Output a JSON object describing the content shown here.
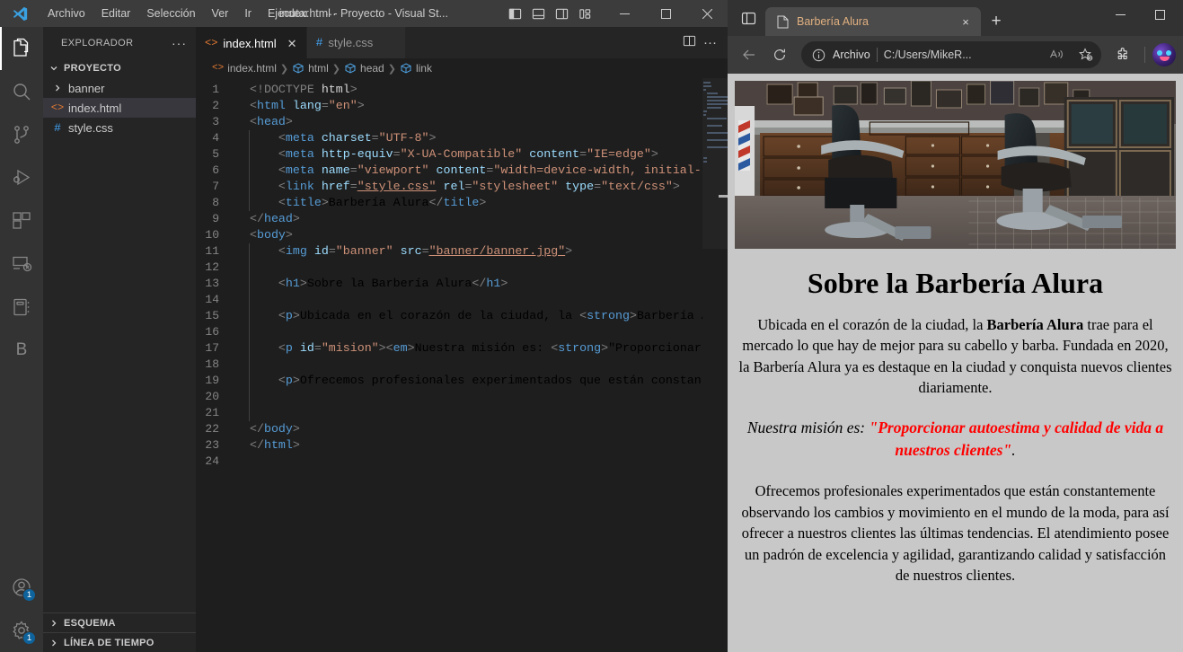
{
  "vscode": {
    "titlebar": {
      "title": "index.html - Proyecto - Visual St...",
      "menu": [
        "Archivo",
        "Editar",
        "Selección",
        "Ver",
        "Ir",
        "Ejecutar",
        "⋯"
      ],
      "layout_icons": [
        "toggle-primary-sidebar-icon",
        "toggle-panel-icon",
        "toggle-secondary-sidebar-icon",
        "customize-layout-icon"
      ],
      "window_buttons": [
        "minimize",
        "maximize",
        "close"
      ]
    },
    "activitybar": [
      {
        "name": "explorer",
        "badge": ""
      },
      {
        "name": "search",
        "badge": ""
      },
      {
        "name": "source-control",
        "badge": ""
      },
      {
        "name": "run-and-debug",
        "badge": ""
      },
      {
        "name": "extensions",
        "badge": ""
      },
      {
        "name": "remote-explorer",
        "badge": ""
      },
      {
        "name": "notebook",
        "badge": ""
      },
      {
        "name": "bookmarks",
        "badge": "",
        "letter": "B"
      },
      {
        "name": "accounts",
        "badge": "1"
      },
      {
        "name": "manage-settings",
        "badge": "1"
      }
    ],
    "sidebar": {
      "header": "EXPLORADOR",
      "more_actions": "···",
      "project": "PROYECTO",
      "files": [
        {
          "label": "banner",
          "type": "folder",
          "selected": false
        },
        {
          "label": "index.html",
          "type": "html",
          "selected": true
        },
        {
          "label": "style.css",
          "type": "css",
          "selected": false
        }
      ],
      "sections": [
        "ESQUEMA",
        "LÍNEA DE TIEMPO"
      ]
    },
    "tabs": [
      {
        "label": "index.html",
        "type": "html",
        "active": true,
        "closable": true
      },
      {
        "label": "style.css",
        "type": "css",
        "active": false,
        "closable": false
      }
    ],
    "tab_actions": [
      "split-editor-icon",
      "more-actions-icon"
    ],
    "breadcrumb": [
      "index.html",
      "html",
      "head",
      "link"
    ],
    "code_lines": [
      {
        "n": 1,
        "text": "<!DOCTYPE html>"
      },
      {
        "n": 2,
        "text": "<html lang=\"en\">"
      },
      {
        "n": 3,
        "text": "<head>"
      },
      {
        "n": 4,
        "text": "    <meta charset=\"UTF-8\">"
      },
      {
        "n": 5,
        "text": "    <meta http-equiv=\"X-UA-Compatible\" content=\"IE=edge\">"
      },
      {
        "n": 6,
        "text": "    <meta name=\"viewport\" content=\"width=device-width, initial-scal"
      },
      {
        "n": 7,
        "text": "    <link href=\"style.css\" rel=\"stylesheet\" type=\"text/css\">"
      },
      {
        "n": 8,
        "text": "    <title>Barbería Alura</title>"
      },
      {
        "n": 9,
        "text": "</head>"
      },
      {
        "n": 10,
        "text": "<body>"
      },
      {
        "n": 11,
        "text": "    <img id=\"banner\" src=\"banner/banner.jpg\">"
      },
      {
        "n": 12,
        "text": ""
      },
      {
        "n": 13,
        "text": "    <h1>Sobre la Barbería Alura</h1>"
      },
      {
        "n": 14,
        "text": ""
      },
      {
        "n": 15,
        "text": "    <p>Ubicada en el corazón de la ciudad, la <strong>Barbería Alur"
      },
      {
        "n": 16,
        "text": ""
      },
      {
        "n": 17,
        "text": "    <p id=\"mision\"><em>Nuestra misión es: <strong>\"Proporcionar aut"
      },
      {
        "n": 18,
        "text": ""
      },
      {
        "n": 19,
        "text": "    <p>Ofrecemos profesionales experimentados que están constantemen"
      },
      {
        "n": 20,
        "text": ""
      },
      {
        "n": 21,
        "text": ""
      },
      {
        "n": 22,
        "text": "</body>"
      },
      {
        "n": 23,
        "text": "</html>"
      },
      {
        "n": 24,
        "text": ""
      }
    ]
  },
  "browser": {
    "tab_search_icon": "tab-search-icon",
    "tab": {
      "title": "Barbería Alura",
      "close_label": "×"
    },
    "new_tab_label": "+",
    "window_buttons": [
      "minimize",
      "maximize"
    ],
    "toolbar": {
      "back_icon": "back-arrow-icon",
      "refresh_icon": "refresh-icon",
      "omnibox": {
        "info_icon": "info-circle-icon",
        "scheme_label": "Archivo",
        "url": "C:/Users/MikeR...",
        "read_aloud_icon": "read-aloud-icon",
        "favorite_icon": "add-favorite-icon"
      },
      "extensions_icon": "extensions-puzzle-icon",
      "profile_icon": "profile-avatar"
    },
    "page": {
      "banner_alt": "barbershop-interior-banner",
      "h1": "Sobre la Barbería Alura",
      "p1_before": "Ubicada en el corazón de la ciudad, la ",
      "p1_strong": "Barbería Alura",
      "p1_after": " trae para el mercado lo que hay de mejor para su cabello y barba. Fundada en 2020, la Barbería Alura ya es destaque en la ciudad y conquista nuevos clientes diariamente.",
      "mision_before": "Nuestra misión es: ",
      "mision_quote": "\"Proporcionar autoestima y calidad de vida a nuestros clientes\"",
      "mision_after": ".",
      "p3": "Ofrecemos profesionales experimentados que están constantemente observando los cambios y movimiento en el mundo de la moda, para así ofrecer a nuestros clientes las últimas tendencias. El atendimiento posee un padrón de excelencia y agilidad, garantizando calidad y satisfacción de nuestros clientes."
    }
  },
  "colors": {
    "vs_titlebar": "#3c3c3c",
    "vs_activitybar": "#333333",
    "vs_sidebar": "#252526",
    "vs_editor": "#1e1e1e",
    "vs_tab_active": "#1e1e1e",
    "vs_selection": "#37373d",
    "accent_badge": "#0e639c",
    "html_icon": "#e37933",
    "css_icon": "#42a5f5",
    "browser_chrome": "#323232",
    "browser_toolbar": "#3b3b3b",
    "page_bg": "#c8c8c8",
    "mision_red": "#ff0000",
    "tab_title": "#e0b080"
  }
}
